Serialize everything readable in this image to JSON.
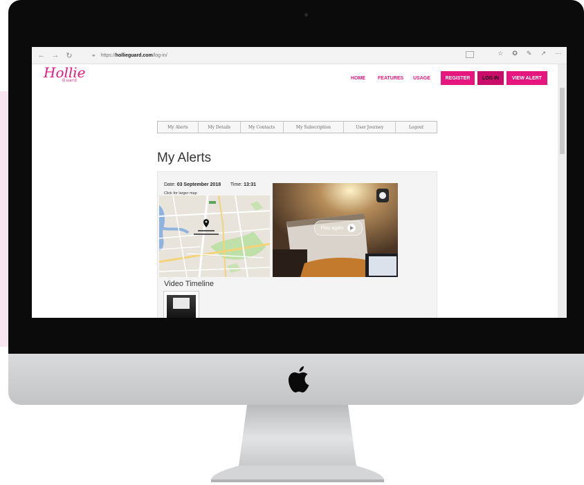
{
  "browser": {
    "url_prefix": "https://",
    "url_host": "hollieguard.com",
    "url_path": "/log-in/"
  },
  "site": {
    "logo": "Hollie",
    "logo_sub": "Guard",
    "nav": [
      "HOME",
      "FEATURES",
      "USAGE"
    ],
    "buttons": [
      "REGISTER",
      "LOG IN",
      "VIEW ALERT"
    ],
    "brand_color": "#e5167d"
  },
  "tabs": [
    "My Alerts",
    "My Details",
    "My Contacts",
    "My Subscription",
    "User Journey",
    "Logout"
  ],
  "page_title": "My Alerts",
  "alert": {
    "date_label": "Date:",
    "date_value": "03 September 2018",
    "time_label": "Time:",
    "time_value": "13:31",
    "map_hint": "Click for larger map",
    "play_label": "Play again",
    "timeline_label": "Video Timeline"
  }
}
